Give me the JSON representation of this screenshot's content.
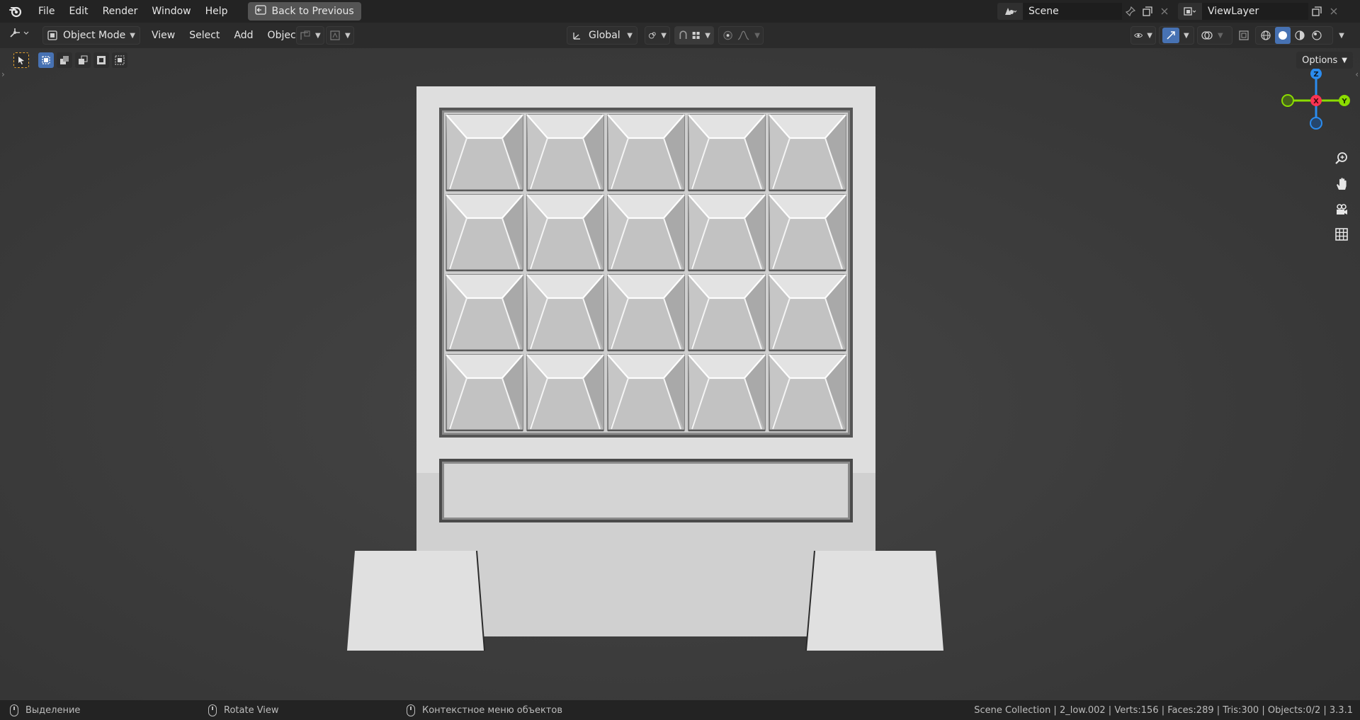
{
  "topbar": {
    "menu": [
      "File",
      "Edit",
      "Render",
      "Window",
      "Help"
    ],
    "back_label": "Back to Previous",
    "scene_name": "Scene",
    "view_layer": "ViewLayer"
  },
  "header": {
    "mode": "Object Mode",
    "menus": [
      "View",
      "Select",
      "Add",
      "Object"
    ],
    "orientation": "Global",
    "options_label": "Options"
  },
  "gizmo": {
    "z": "Z",
    "x": "X",
    "y": "Y"
  },
  "statusbar": {
    "left_action": "Выделение",
    "middle_action": "Rotate View",
    "right_action": "Контекстное меню объектов",
    "stats": "Scene Collection | 2_low.002 | Verts:156 | Faces:289 | Tris:300 | Objects:0/2 | 3.3.1"
  },
  "icons": [
    "blender-logo-icon",
    "back-icon",
    "scene-icon",
    "pin-icon",
    "copy-icon",
    "close-icon",
    "viewlayer-icon",
    "editor-type-icon",
    "cursor-tool-icon",
    "box-select-icon",
    "zoom-icon",
    "hand-pan-icon",
    "camera-icon",
    "grid-icon"
  ],
  "colors": {
    "accent": "#4772b3",
    "x_axis": "#ff3352",
    "y_axis": "#8bdc00",
    "z_axis": "#2b8cef"
  }
}
